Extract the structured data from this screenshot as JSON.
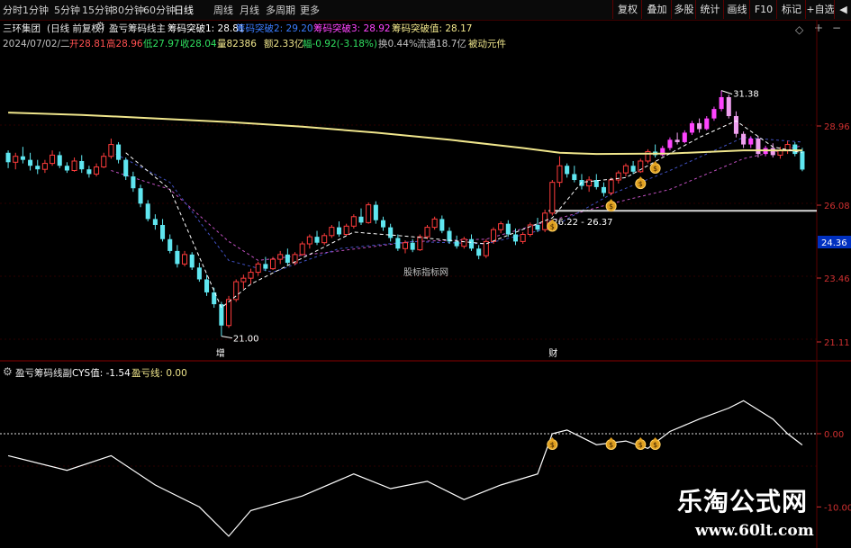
{
  "toolbar": {
    "timeframes": [
      "分时",
      "1分钟",
      "5分钟",
      "15分钟",
      "30分钟",
      "60分钟",
      "日线",
      "周线",
      "月线",
      "多周期",
      "更多"
    ],
    "selected_timeframe": "日线",
    "buttons": [
      "复权",
      "叠加",
      "多股",
      "统计",
      "画线",
      "F10",
      "标记",
      "+自选",
      "◀"
    ]
  },
  "header": {
    "stock_name": "三环集团",
    "period_tag": "(日线 前复权)",
    "indicator_title": "盈亏筹码线主",
    "chip1": "筹码突破1: 28.81",
    "chip2": "筹码突破2: 29.20",
    "chip3": "筹码突破3: 28.92",
    "chip_value": "筹码突破值: 28.17"
  },
  "quote": {
    "date": "2024/07/02/二",
    "open": "开28.81",
    "high": "高28.96",
    "low": "低27.97",
    "close": "收28.04",
    "volume": "量82386",
    "amount": "额2.33亿",
    "change": "幅-0.92(-3.18%)",
    "turnover": "换0.44%",
    "float_value": "流通18.7亿",
    "extra": "被动元件"
  },
  "colors": {
    "up": "#ff3c3c",
    "down": "#5fe6f0",
    "breakout": "#ff44ff",
    "yellow_line": "#f0e68c",
    "grid": "#5a0000",
    "axis_label": "#d03030"
  },
  "main_chart": {
    "y_ticks": [
      "28.96",
      "26.08",
      "23.46",
      "21.11"
    ],
    "current_price_label": "24.36",
    "annotations": {
      "high": "31.38",
      "low": "21.00",
      "range": "26.22 - 26.37",
      "event1": "增",
      "event2": "财",
      "watermark": "股标指标网"
    }
  },
  "sub_chart": {
    "title": "盈亏筹码线副",
    "cys": "CYS值: -1.54",
    "pnl": "盈亏线: 0.00",
    "y_ticks": [
      "0.00",
      "-10.00"
    ]
  },
  "watermark": {
    "name": "乐淘公式网",
    "url": "www.60lt.com"
  },
  "chart_data": {
    "type": "line",
    "ylim": [
      20.3,
      33.0
    ],
    "ohlc": [
      [
        28.75,
        28.85,
        28.1,
        28.35
      ],
      [
        28.35,
        28.75,
        28.05,
        28.6
      ],
      [
        28.6,
        29.0,
        28.3,
        28.45
      ],
      [
        28.45,
        28.75,
        28.0,
        28.2
      ],
      [
        28.2,
        28.45,
        27.85,
        28.05
      ],
      [
        28.05,
        28.45,
        27.9,
        28.3
      ],
      [
        28.3,
        28.85,
        28.2,
        28.65
      ],
      [
        28.65,
        28.8,
        28.1,
        28.2
      ],
      [
        28.2,
        28.35,
        27.9,
        28.0
      ],
      [
        28.0,
        28.55,
        27.95,
        28.4
      ],
      [
        28.4,
        28.65,
        27.9,
        28.05
      ],
      [
        28.05,
        28.2,
        27.7,
        27.85
      ],
      [
        27.85,
        28.3,
        27.75,
        28.15
      ],
      [
        28.15,
        28.75,
        28.1,
        28.6
      ],
      [
        28.6,
        29.35,
        28.5,
        29.1
      ],
      [
        29.1,
        29.2,
        28.3,
        28.45
      ],
      [
        28.45,
        28.55,
        27.6,
        27.75
      ],
      [
        27.75,
        27.95,
        27.1,
        27.25
      ],
      [
        27.25,
        27.4,
        26.45,
        26.6
      ],
      [
        26.6,
        26.75,
        25.85,
        25.95
      ],
      [
        25.95,
        26.15,
        25.5,
        25.7
      ],
      [
        25.7,
        25.95,
        25.0,
        25.1
      ],
      [
        25.1,
        25.3,
        24.5,
        24.6
      ],
      [
        24.6,
        24.85,
        23.9,
        24.05
      ],
      [
        24.05,
        24.6,
        23.95,
        24.45
      ],
      [
        24.45,
        24.55,
        23.8,
        23.9
      ],
      [
        23.9,
        24.1,
        23.3,
        23.4
      ],
      [
        23.4,
        23.6,
        22.7,
        22.85
      ],
      [
        22.85,
        23.05,
        22.2,
        22.35
      ],
      [
        22.35,
        22.45,
        21.0,
        21.45
      ],
      [
        21.45,
        22.7,
        21.35,
        22.55
      ],
      [
        22.55,
        23.4,
        22.45,
        23.3
      ],
      [
        23.3,
        23.6,
        23.0,
        23.45
      ],
      [
        23.45,
        23.85,
        23.2,
        23.7
      ],
      [
        23.7,
        24.15,
        23.55,
        24.05
      ],
      [
        24.05,
        24.35,
        23.75,
        23.85
      ],
      [
        23.85,
        24.35,
        23.8,
        24.25
      ],
      [
        24.25,
        24.6,
        24.05,
        24.45
      ],
      [
        24.45,
        24.7,
        24.0,
        24.1
      ],
      [
        24.1,
        24.55,
        24.0,
        24.45
      ],
      [
        24.45,
        25.0,
        24.4,
        24.9
      ],
      [
        24.9,
        25.3,
        24.7,
        25.2
      ],
      [
        25.2,
        25.45,
        24.85,
        24.95
      ],
      [
        24.95,
        25.35,
        24.85,
        25.25
      ],
      [
        25.25,
        25.7,
        25.15,
        25.6
      ],
      [
        25.6,
        25.85,
        25.2,
        25.3
      ],
      [
        25.3,
        25.75,
        25.25,
        25.65
      ],
      [
        25.65,
        26.15,
        25.55,
        26.05
      ],
      [
        26.05,
        26.4,
        25.7,
        25.8
      ],
      [
        25.8,
        26.65,
        25.75,
        26.55
      ],
      [
        26.55,
        26.7,
        25.75,
        25.9
      ],
      [
        25.9,
        26.05,
        25.45,
        25.6
      ],
      [
        25.6,
        25.75,
        25.0,
        25.15
      ],
      [
        25.15,
        25.3,
        24.6,
        24.7
      ],
      [
        24.7,
        25.05,
        24.5,
        24.95
      ],
      [
        24.95,
        25.1,
        24.55,
        24.65
      ],
      [
        24.65,
        25.3,
        24.6,
        25.2
      ],
      [
        25.2,
        25.7,
        25.1,
        25.6
      ],
      [
        25.6,
        26.05,
        25.5,
        25.95
      ],
      [
        25.95,
        26.1,
        25.35,
        25.45
      ],
      [
        25.45,
        25.6,
        24.9,
        25.0
      ],
      [
        25.0,
        25.25,
        24.7,
        24.8
      ],
      [
        24.8,
        25.2,
        24.7,
        25.1
      ],
      [
        25.1,
        25.3,
        24.6,
        24.7
      ],
      [
        24.7,
        24.85,
        24.25,
        24.4
      ],
      [
        24.4,
        25.1,
        24.3,
        25.0
      ],
      [
        25.0,
        25.6,
        24.9,
        25.5
      ],
      [
        25.5,
        25.85,
        25.35,
        25.75
      ],
      [
        25.75,
        25.9,
        25.2,
        25.3
      ],
      [
        25.3,
        25.55,
        24.85,
        25.0
      ],
      [
        25.0,
        25.4,
        24.9,
        25.3
      ],
      [
        25.3,
        25.8,
        25.2,
        25.7
      ],
      [
        25.7,
        26.0,
        25.4,
        25.5
      ],
      [
        25.5,
        26.35,
        25.4,
        26.2
      ],
      [
        26.2,
        27.6,
        26.1,
        27.5
      ],
      [
        27.5,
        28.6,
        27.3,
        28.2
      ],
      [
        28.2,
        28.3,
        27.7,
        27.85
      ],
      [
        27.85,
        28.2,
        27.5,
        27.6
      ],
      [
        27.6,
        27.85,
        27.2,
        27.35
      ],
      [
        27.35,
        27.75,
        27.1,
        27.6
      ],
      [
        27.6,
        27.85,
        27.2,
        27.3
      ],
      [
        27.3,
        27.5,
        26.9,
        27.05
      ],
      [
        27.05,
        27.7,
        26.95,
        27.6
      ],
      [
        27.6,
        28.0,
        27.45,
        27.9
      ],
      [
        27.9,
        28.3,
        27.75,
        28.2
      ],
      [
        28.2,
        28.4,
        27.85,
        27.95
      ],
      [
        27.95,
        28.5,
        27.9,
        28.4
      ],
      [
        28.4,
        28.9,
        28.3,
        28.8
      ],
      [
        28.8,
        29.1,
        28.55,
        28.65
      ],
      [
        28.65,
        29.05,
        28.6,
        28.95
      ],
      [
        28.95,
        29.4,
        28.85,
        29.3
      ],
      [
        29.3,
        29.6,
        29.1,
        29.2
      ],
      [
        29.2,
        29.7,
        29.15,
        29.6
      ],
      [
        29.6,
        30.1,
        29.5,
        30.0
      ],
      [
        30.0,
        30.2,
        29.6,
        29.75
      ],
      [
        29.75,
        30.3,
        29.7,
        30.2
      ],
      [
        30.2,
        30.7,
        30.1,
        30.6
      ],
      [
        30.6,
        31.38,
        30.5,
        31.1
      ],
      [
        31.1,
        31.2,
        30.2,
        30.3
      ],
      [
        30.3,
        30.5,
        29.4,
        29.55
      ],
      [
        29.55,
        29.65,
        28.95,
        29.1
      ],
      [
        29.1,
        29.45,
        28.95,
        29.35
      ],
      [
        29.35,
        29.45,
        28.55,
        28.7
      ],
      [
        28.7,
        29.05,
        28.6,
        28.95
      ],
      [
        28.95,
        29.15,
        28.55,
        28.65
      ],
      [
        28.65,
        29.0,
        28.5,
        28.85
      ],
      [
        28.85,
        29.25,
        28.7,
        29.1
      ],
      [
        29.1,
        29.2,
        28.6,
        28.7
      ],
      [
        28.81,
        28.96,
        27.97,
        28.04
      ]
    ],
    "yellow_line": [
      [
        0,
        30.45
      ],
      [
        10,
        30.35
      ],
      [
        20,
        30.2
      ],
      [
        30,
        30.05
      ],
      [
        40,
        29.85
      ],
      [
        50,
        29.6
      ],
      [
        60,
        29.3
      ],
      [
        70,
        28.95
      ],
      [
        75,
        28.75
      ],
      [
        80,
        28.7
      ],
      [
        90,
        28.72
      ],
      [
        100,
        28.85
      ],
      [
        108,
        28.85
      ]
    ],
    "white_line": [
      [
        16,
        28.75
      ],
      [
        22,
        27.2
      ],
      [
        29,
        22.2
      ],
      [
        33,
        23.2
      ],
      [
        40,
        24.3
      ],
      [
        47,
        25.4
      ],
      [
        55,
        25.2
      ],
      [
        65,
        24.9
      ],
      [
        74,
        26.0
      ],
      [
        78,
        27.5
      ],
      [
        84,
        27.7
      ],
      [
        94,
        29.4
      ],
      [
        99,
        30.1
      ],
      [
        104,
        29.0
      ],
      [
        108,
        28.75
      ]
    ],
    "blue_line": [
      [
        14,
        28.8
      ],
      [
        22,
        27.5
      ],
      [
        30,
        24.2
      ],
      [
        36,
        23.7
      ],
      [
        45,
        24.7
      ],
      [
        55,
        25.0
      ],
      [
        65,
        24.9
      ],
      [
        74,
        25.6
      ],
      [
        82,
        27.0
      ],
      [
        90,
        28.0
      ],
      [
        100,
        29.4
      ],
      [
        108,
        29.2
      ]
    ],
    "pink_line": [
      [
        14,
        28.0
      ],
      [
        22,
        27.2
      ],
      [
        30,
        25.0
      ],
      [
        34,
        24.2
      ],
      [
        45,
        24.6
      ],
      [
        55,
        25.0
      ],
      [
        65,
        25.1
      ],
      [
        74,
        25.9
      ],
      [
        82,
        26.6
      ],
      [
        90,
        27.2
      ],
      [
        100,
        28.5
      ],
      [
        108,
        29.05
      ]
    ],
    "support_level": 26.3,
    "breakout_markers": [
      74,
      82,
      86,
      88
    ],
    "cys_ylim": [
      -14.5,
      7.0
    ],
    "cys": [
      [
        0,
        -3.0
      ],
      [
        8,
        -5.0
      ],
      [
        14,
        -3.0
      ],
      [
        20,
        -7.0
      ],
      [
        26,
        -10.0
      ],
      [
        30,
        -14.0
      ],
      [
        33,
        -10.5
      ],
      [
        40,
        -8.5
      ],
      [
        47,
        -5.5
      ],
      [
        52,
        -7.5
      ],
      [
        57,
        -6.5
      ],
      [
        62,
        -9.0
      ],
      [
        67,
        -7.0
      ],
      [
        72,
        -5.5
      ],
      [
        74,
        0.0
      ],
      [
        76,
        0.5
      ],
      [
        80,
        -1.5
      ],
      [
        84,
        -1.0
      ],
      [
        87,
        -2.0
      ],
      [
        90,
        0.3
      ],
      [
        94,
        2.0
      ],
      [
        98,
        3.5
      ],
      [
        100,
        4.5
      ],
      [
        104,
        2.0
      ],
      [
        106,
        0.0
      ],
      [
        108,
        -1.54
      ]
    ]
  }
}
